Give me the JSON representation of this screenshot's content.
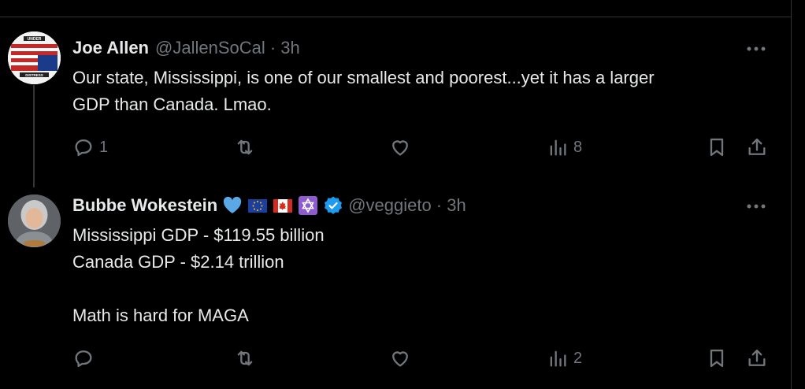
{
  "tweets": [
    {
      "name": "Joe Allen",
      "handle": "@JallenSoCal · 3h",
      "text_lines": [
        "Our state, Mississippi, is one of our smallest and poorest...yet it has a larger",
        "GDP than Canada.   Lmao."
      ],
      "avatar_text": [
        "UNDER",
        "DISTRESS"
      ],
      "actions": {
        "reply_count": "1",
        "retweet_count": "",
        "like_count": "",
        "view_count": "8"
      }
    },
    {
      "name": "Bubbe Wokestein",
      "badges": [
        "blue-heart-icon",
        "eu-flag-icon",
        "canada-flag-icon",
        "star-of-david-icon",
        "verified-badge-icon"
      ],
      "handle": "@veggieto · 3h",
      "text_lines": [
        "Mississippi GDP - $119.55 billion",
        "Canada GDP - $2.14 trillion",
        "",
        "Math is hard for MAGA"
      ],
      "actions": {
        "reply_count": "",
        "retweet_count": "",
        "like_count": "",
        "view_count": "2"
      }
    }
  ],
  "colors": {
    "background": "#000000",
    "text": "#e7e9ea",
    "muted": "#71767b",
    "divider": "#2f3336",
    "verified": "#1d9bf0"
  }
}
